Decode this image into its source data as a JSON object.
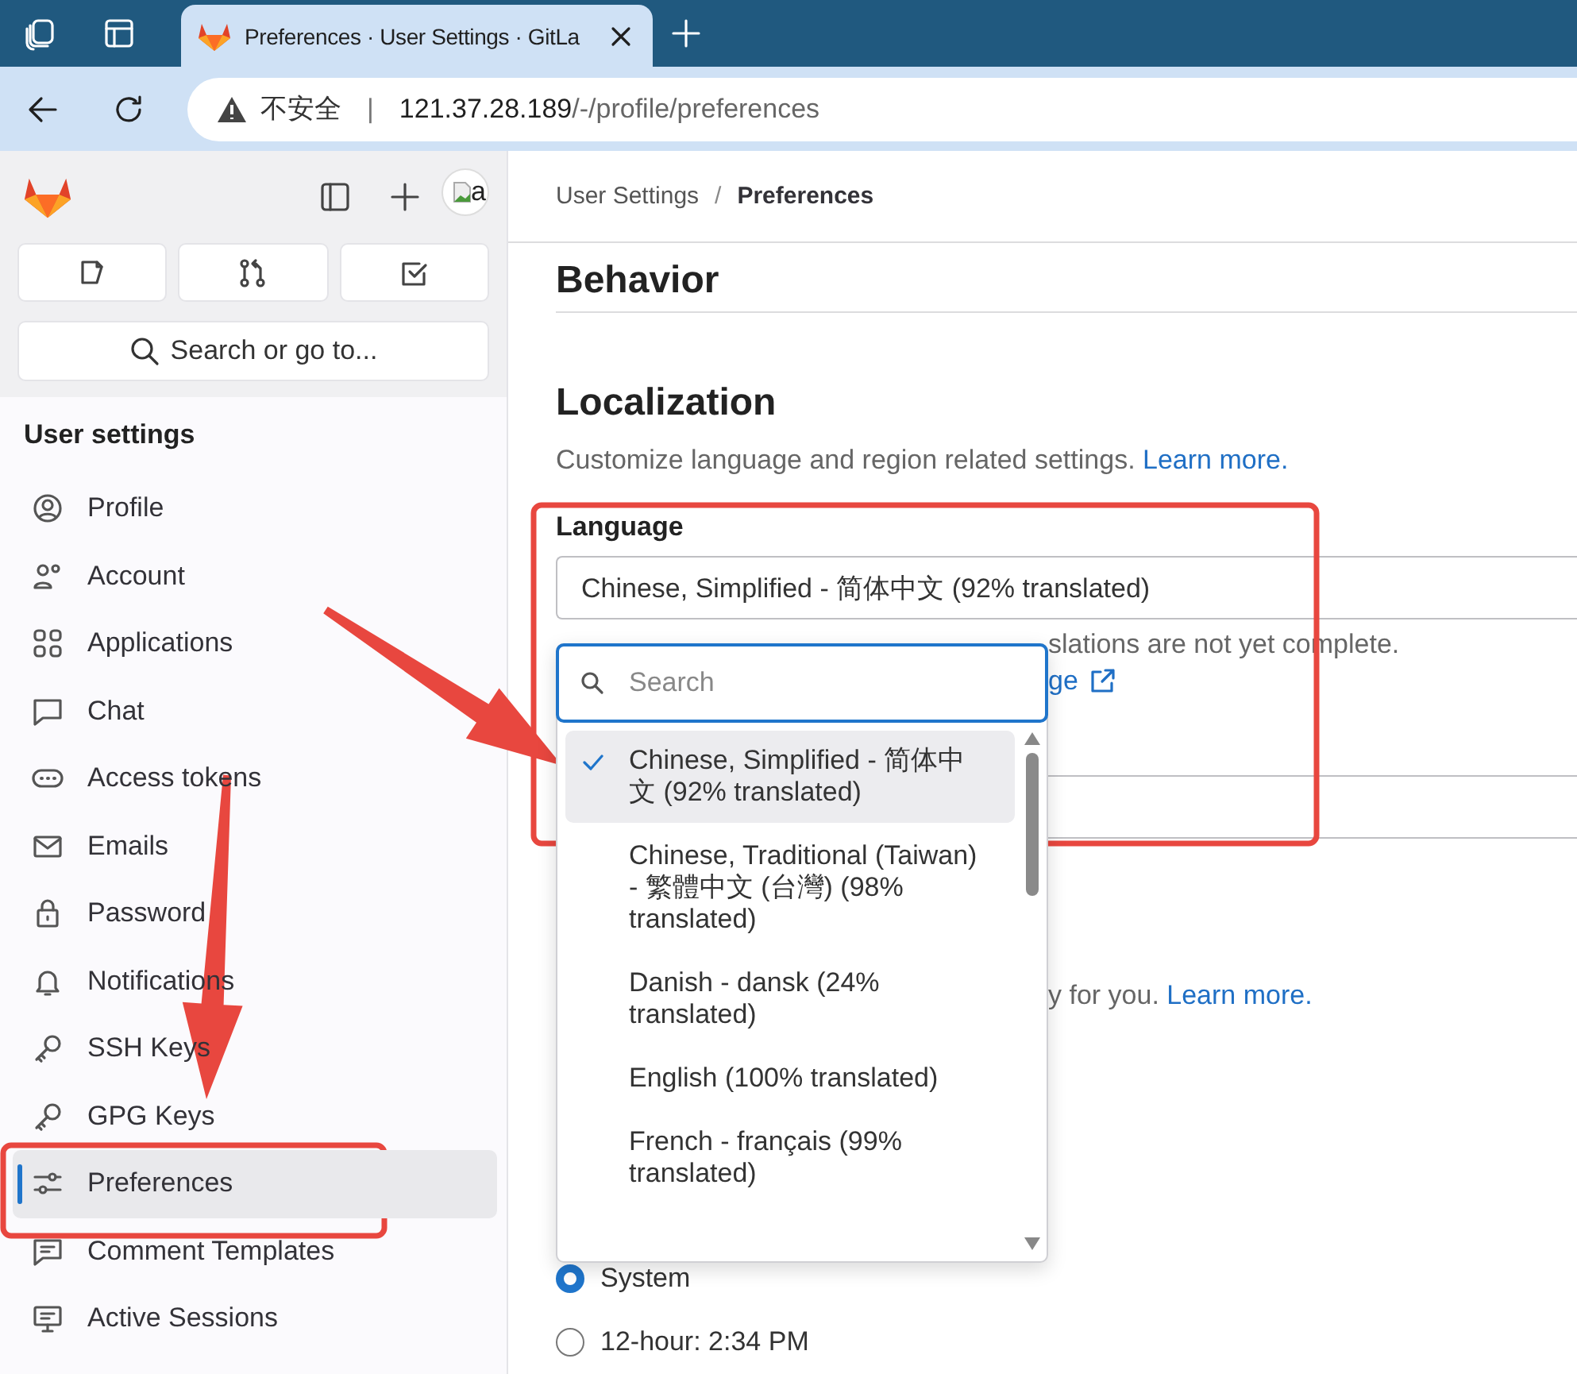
{
  "browser": {
    "tabs": [
      {
        "title": "Preferences · User Settings · GitLa",
        "selected": true
      }
    ],
    "address": {
      "warning": "不安全",
      "separator": "|",
      "host": "121.37.28.189",
      "path": "/-/profile/preferences"
    }
  },
  "sidebar": {
    "avatar_alt": "a",
    "search": "Search or go to...",
    "section_title": "User settings",
    "items": [
      {
        "label": "Profile",
        "selected": false
      },
      {
        "label": "Account",
        "selected": false
      },
      {
        "label": "Applications",
        "selected": false
      },
      {
        "label": "Chat",
        "selected": false
      },
      {
        "label": "Access tokens",
        "selected": false
      },
      {
        "label": "Emails",
        "selected": false
      },
      {
        "label": "Password",
        "selected": false
      },
      {
        "label": "Notifications",
        "selected": false
      },
      {
        "label": "SSH Keys",
        "selected": false
      },
      {
        "label": "GPG Keys",
        "selected": false
      },
      {
        "label": "Preferences",
        "selected": true
      },
      {
        "label": "Comment Templates",
        "selected": false
      },
      {
        "label": "Active Sessions",
        "selected": false
      }
    ]
  },
  "breadcrumb": {
    "separator": "/",
    "items": [
      {
        "label": "User Settings",
        "current": false
      },
      {
        "label": "Preferences",
        "current": true
      }
    ]
  },
  "behavior": {
    "title": "Behavior"
  },
  "localization": {
    "title": "Localization",
    "description": "Customize language and region related settings.",
    "description_link": "Learn more.",
    "language": {
      "label": "Language",
      "value": "Chinese, Simplified - 简体中文 (92% translated)",
      "help_fragment": "slations are not yet complete.",
      "help_link_fragment": "ge"
    },
    "time_hint_fragment": "y for you.",
    "time_hint_link": "Learn more.",
    "time_format": [
      {
        "label": "System",
        "selected": true
      },
      {
        "label": "12-hour: 2:34 PM",
        "selected": false
      }
    ]
  },
  "dropdown": {
    "search_placeholder": "Search",
    "options": [
      {
        "label": "Chinese, Simplified - 简体中文 (92% translated)",
        "selected": true
      },
      {
        "label": "Chinese, Traditional (Taiwan) - 繁體中文 (台灣) (98% translated)",
        "selected": false
      },
      {
        "label": "Danish - dansk (24% translated)",
        "selected": false
      },
      {
        "label": "English (100% translated)",
        "selected": false
      },
      {
        "label": "French - français (99% translated)",
        "selected": false
      }
    ]
  },
  "annotations": [
    {
      "kind": "box"
    },
    {
      "kind": "box"
    },
    {
      "kind": "arrow"
    },
    {
      "kind": "arrow"
    }
  ]
}
